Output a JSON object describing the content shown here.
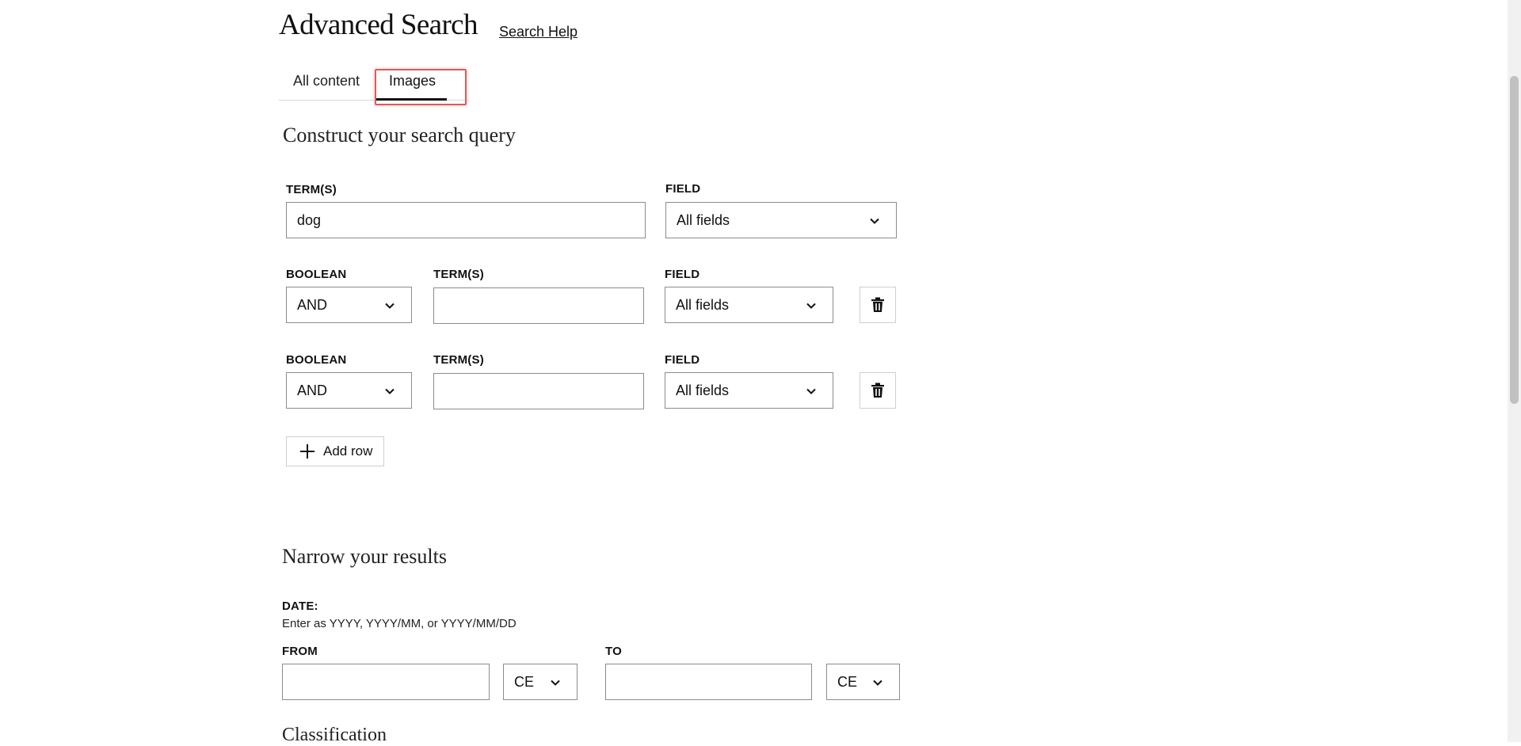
{
  "header": {
    "title": "Advanced Search",
    "help_link": "Search Help"
  },
  "tabs": [
    {
      "label": "All content",
      "selected": false
    },
    {
      "label": "Images",
      "selected": true
    }
  ],
  "query": {
    "section_title": "Construct your search query",
    "first_row": {
      "term_label": "TERM(S)",
      "term_value": "dog",
      "field_label": "FIELD",
      "field_value": "All fields"
    },
    "rows": [
      {
        "boolean_label": "BOOLEAN",
        "boolean_value": "AND",
        "term_label": "TERM(S)",
        "term_value": "",
        "field_label": "FIELD",
        "field_value": "All fields"
      },
      {
        "boolean_label": "BOOLEAN",
        "boolean_value": "AND",
        "term_label": "TERM(S)",
        "term_value": "",
        "field_label": "FIELD",
        "field_value": "All fields"
      }
    ],
    "add_row_label": "Add row"
  },
  "narrow": {
    "section_title": "Narrow your results",
    "date_label": "DATE:",
    "date_hint": "Enter as YYYY, YYYY/MM, or YYYY/MM/DD",
    "from_label": "FROM",
    "from_value": "",
    "from_era": "CE",
    "to_label": "TO",
    "to_value": "",
    "to_era": "CE"
  },
  "classification": {
    "section_title": "Classification"
  },
  "colors": {
    "highlight": "#e05a5a",
    "text": "#111111",
    "border": "#8c8c8c"
  }
}
